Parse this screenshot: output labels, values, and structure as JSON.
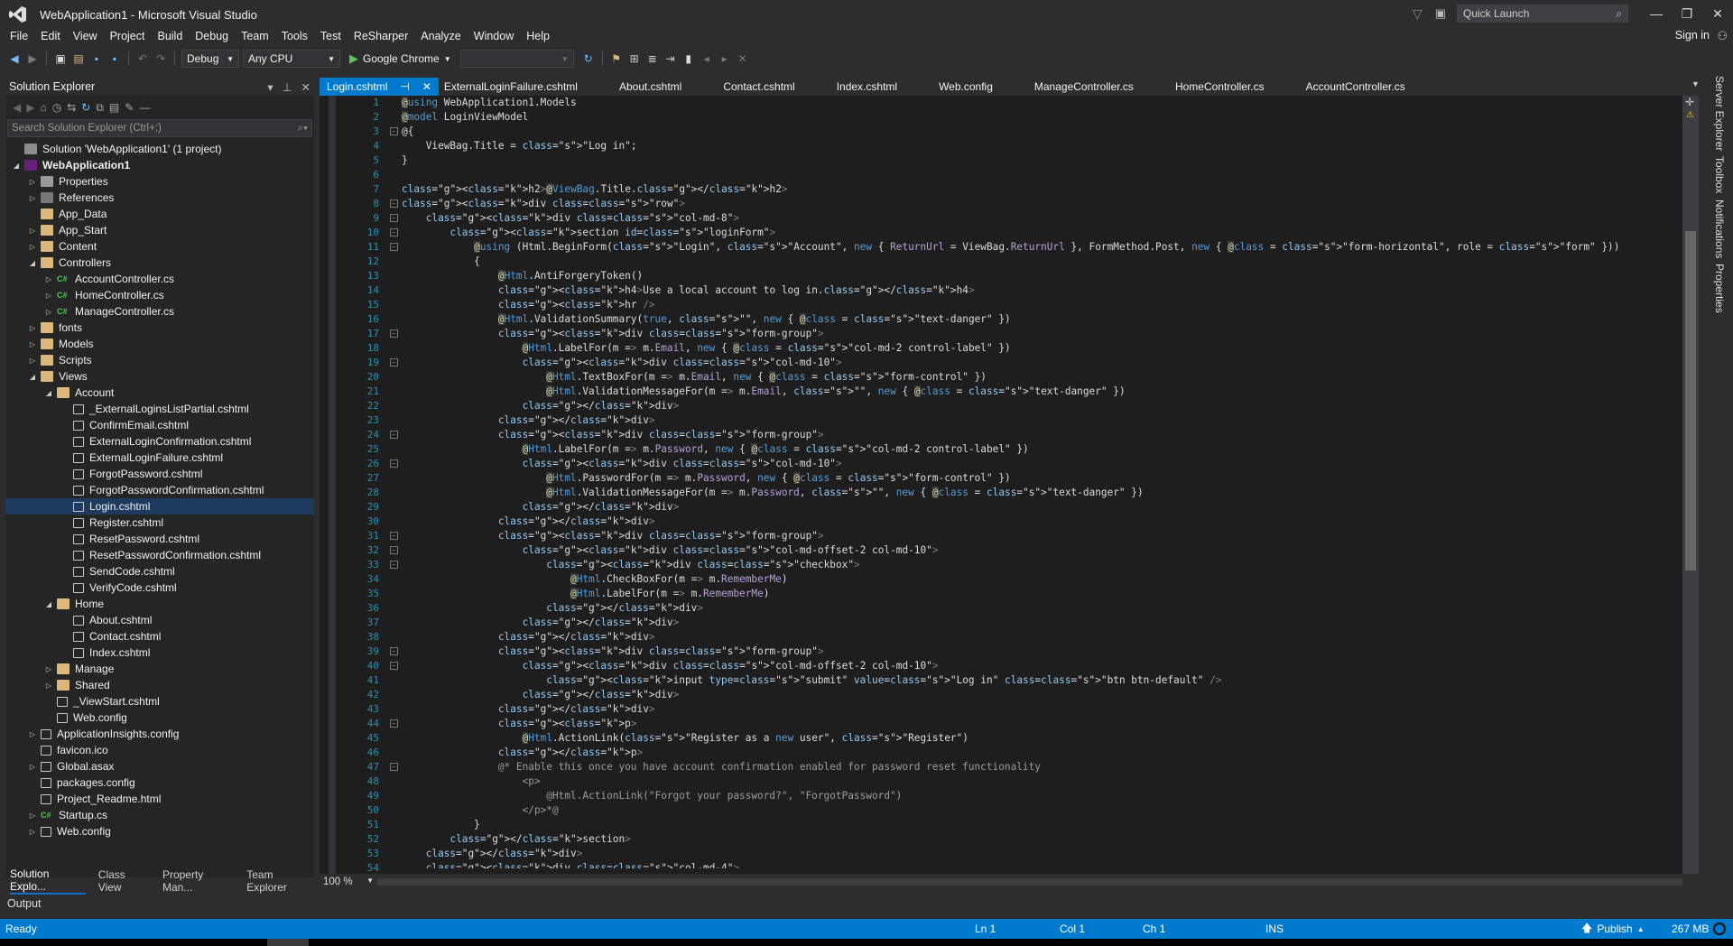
{
  "window": {
    "title": "WebApplication1 - Microsoft Visual Studio",
    "quick_launch_placeholder": "Quick Launch",
    "sign_in": "Sign in"
  },
  "menu": [
    "File",
    "Edit",
    "View",
    "Project",
    "Build",
    "Debug",
    "Team",
    "Tools",
    "Test",
    "ReSharper",
    "Analyze",
    "Window",
    "Help"
  ],
  "toolbar": {
    "configuration": "Debug",
    "platform": "Any CPU",
    "run_target": "Google Chrome",
    "empty_combo": ""
  },
  "solution_explorer": {
    "title": "Solution Explorer",
    "search_placeholder": "Search Solution Explorer (Ctrl+;)",
    "tree": [
      {
        "label": "Solution 'WebApplication1' (1 project)",
        "depth": 0,
        "icon": "sol",
        "arrow": ""
      },
      {
        "label": "WebApplication1",
        "depth": 0,
        "icon": "proj",
        "arrow": "open",
        "bold": true
      },
      {
        "label": "Properties",
        "depth": 1,
        "icon": "props",
        "arrow": "closed"
      },
      {
        "label": "References",
        "depth": 1,
        "icon": "refs",
        "arrow": "closed"
      },
      {
        "label": "App_Data",
        "depth": 1,
        "icon": "folder",
        "arrow": ""
      },
      {
        "label": "App_Start",
        "depth": 1,
        "icon": "folder",
        "arrow": "closed"
      },
      {
        "label": "Content",
        "depth": 1,
        "icon": "folder",
        "arrow": "closed"
      },
      {
        "label": "Controllers",
        "depth": 1,
        "icon": "folder",
        "arrow": "open"
      },
      {
        "label": "AccountController.cs",
        "depth": 2,
        "icon": "cs",
        "arrow": "closed"
      },
      {
        "label": "HomeController.cs",
        "depth": 2,
        "icon": "cs",
        "arrow": "closed"
      },
      {
        "label": "ManageController.cs",
        "depth": 2,
        "icon": "cs",
        "arrow": "closed"
      },
      {
        "label": "fonts",
        "depth": 1,
        "icon": "folder",
        "arrow": "closed"
      },
      {
        "label": "Models",
        "depth": 1,
        "icon": "folder",
        "arrow": "closed"
      },
      {
        "label": "Scripts",
        "depth": 1,
        "icon": "folder",
        "arrow": "closed"
      },
      {
        "label": "Views",
        "depth": 1,
        "icon": "folder",
        "arrow": "open"
      },
      {
        "label": "Account",
        "depth": 2,
        "icon": "folder",
        "arrow": "open"
      },
      {
        "label": "_ExternalLoginsListPartial.cshtml",
        "depth": 3,
        "icon": "file",
        "arrow": ""
      },
      {
        "label": "ConfirmEmail.cshtml",
        "depth": 3,
        "icon": "file",
        "arrow": ""
      },
      {
        "label": "ExternalLoginConfirmation.cshtml",
        "depth": 3,
        "icon": "file",
        "arrow": ""
      },
      {
        "label": "ExternalLoginFailure.cshtml",
        "depth": 3,
        "icon": "file",
        "arrow": ""
      },
      {
        "label": "ForgotPassword.cshtml",
        "depth": 3,
        "icon": "file",
        "arrow": ""
      },
      {
        "label": "ForgotPasswordConfirmation.cshtml",
        "depth": 3,
        "icon": "file",
        "arrow": ""
      },
      {
        "label": "Login.cshtml",
        "depth": 3,
        "icon": "file",
        "arrow": "",
        "selected": true
      },
      {
        "label": "Register.cshtml",
        "depth": 3,
        "icon": "file",
        "arrow": ""
      },
      {
        "label": "ResetPassword.cshtml",
        "depth": 3,
        "icon": "file",
        "arrow": ""
      },
      {
        "label": "ResetPasswordConfirmation.cshtml",
        "depth": 3,
        "icon": "file",
        "arrow": ""
      },
      {
        "label": "SendCode.cshtml",
        "depth": 3,
        "icon": "file",
        "arrow": ""
      },
      {
        "label": "VerifyCode.cshtml",
        "depth": 3,
        "icon": "file",
        "arrow": ""
      },
      {
        "label": "Home",
        "depth": 2,
        "icon": "folder",
        "arrow": "open"
      },
      {
        "label": "About.cshtml",
        "depth": 3,
        "icon": "file",
        "arrow": ""
      },
      {
        "label": "Contact.cshtml",
        "depth": 3,
        "icon": "file",
        "arrow": ""
      },
      {
        "label": "Index.cshtml",
        "depth": 3,
        "icon": "file",
        "arrow": ""
      },
      {
        "label": "Manage",
        "depth": 2,
        "icon": "folder",
        "arrow": "closed"
      },
      {
        "label": "Shared",
        "depth": 2,
        "icon": "folder",
        "arrow": "closed"
      },
      {
        "label": "_ViewStart.cshtml",
        "depth": 2,
        "icon": "file",
        "arrow": ""
      },
      {
        "label": "Web.config",
        "depth": 2,
        "icon": "file",
        "arrow": ""
      },
      {
        "label": "ApplicationInsights.config",
        "depth": 1,
        "icon": "file",
        "arrow": "closed"
      },
      {
        "label": "favicon.ico",
        "depth": 1,
        "icon": "file",
        "arrow": ""
      },
      {
        "label": "Global.asax",
        "depth": 1,
        "icon": "file",
        "arrow": "closed"
      },
      {
        "label": "packages.config",
        "depth": 1,
        "icon": "file",
        "arrow": ""
      },
      {
        "label": "Project_Readme.html",
        "depth": 1,
        "icon": "file",
        "arrow": ""
      },
      {
        "label": "Startup.cs",
        "depth": 1,
        "icon": "cs",
        "arrow": "closed"
      },
      {
        "label": "Web.config",
        "depth": 1,
        "icon": "file",
        "arrow": "closed"
      }
    ],
    "bottom_tabs": [
      "Solution Explo...",
      "Class View",
      "Property Man...",
      "Team Explorer"
    ]
  },
  "editor": {
    "tabs": [
      "Login.cshtml",
      "ExternalLoginFailure.cshtml",
      "About.cshtml",
      "Contact.cshtml",
      "Index.cshtml",
      "Web.config",
      "ManageController.cs",
      "HomeController.cs",
      "AccountController.cs"
    ],
    "zoom": "100 %",
    "lines": [
      "@using WebApplication1.Models",
      "@model LoginViewModel",
      "@{",
      "    ViewBag.Title = \"Log in\";",
      "}",
      "",
      "<h2>@ViewBag.Title.</h2>",
      "<div class=\"row\">",
      "    <div class=\"col-md-8\">",
      "        <section id=\"loginForm\">",
      "            @using (Html.BeginForm(\"Login\", \"Account\", new { ReturnUrl = ViewBag.ReturnUrl }, FormMethod.Post, new { @class = \"form-horizontal\", role = \"form\" }))",
      "            {",
      "                @Html.AntiForgeryToken()",
      "                <h4>Use a local account to log in.</h4>",
      "                <hr />",
      "                @Html.ValidationSummary(true, \"\", new { @class = \"text-danger\" })",
      "                <div class=\"form-group\">",
      "                    @Html.LabelFor(m => m.Email, new { @class = \"col-md-2 control-label\" })",
      "                    <div class=\"col-md-10\">",
      "                        @Html.TextBoxFor(m => m.Email, new { @class = \"form-control\" })",
      "                        @Html.ValidationMessageFor(m => m.Email, \"\", new { @class = \"text-danger\" })",
      "                    </div>",
      "                </div>",
      "                <div class=\"form-group\">",
      "                    @Html.LabelFor(m => m.Password, new { @class = \"col-md-2 control-label\" })",
      "                    <div class=\"col-md-10\">",
      "                        @Html.PasswordFor(m => m.Password, new { @class = \"form-control\" })",
      "                        @Html.ValidationMessageFor(m => m.Password, \"\", new { @class = \"text-danger\" })",
      "                    </div>",
      "                </div>",
      "                <div class=\"form-group\">",
      "                    <div class=\"col-md-offset-2 col-md-10\">",
      "                        <div class=\"checkbox\">",
      "                            @Html.CheckBoxFor(m => m.RememberMe)",
      "                            @Html.LabelFor(m => m.RememberMe)",
      "                        </div>",
      "                    </div>",
      "                </div>",
      "                <div class=\"form-group\">",
      "                    <div class=\"col-md-offset-2 col-md-10\">",
      "                        <input type=\"submit\" value=\"Log in\" class=\"btn btn-default\" />",
      "                    </div>",
      "                </div>",
      "                <p>",
      "                    @Html.ActionLink(\"Register as a new user\", \"Register\")",
      "                </p>",
      "                @* Enable this once you have account confirmation enabled for password reset functionality",
      "                    <p>",
      "                        @Html.ActionLink(\"Forgot your password?\", \"ForgotPassword\")",
      "                    </p>*@",
      "            }",
      "        </section>",
      "    </div>",
      "    <div class=\"col-md-4\">"
    ],
    "fold_lines": [
      3,
      8,
      9,
      10,
      11,
      17,
      19,
      24,
      26,
      31,
      32,
      33,
      39,
      40,
      44,
      47
    ]
  },
  "output_label": "Output",
  "right_strip": [
    "Server Explorer",
    "Toolbox",
    "Notifications",
    "Properties"
  ],
  "status": {
    "ready": "Ready",
    "ln": "Ln 1",
    "col": "Col 1",
    "ch": "Ch 1",
    "ins": "INS",
    "publish": "Publish",
    "memory": "267 MB"
  },
  "colors": {
    "accent": "#007acc",
    "background": "#2d2d30",
    "editor": "#1e1e1e"
  }
}
